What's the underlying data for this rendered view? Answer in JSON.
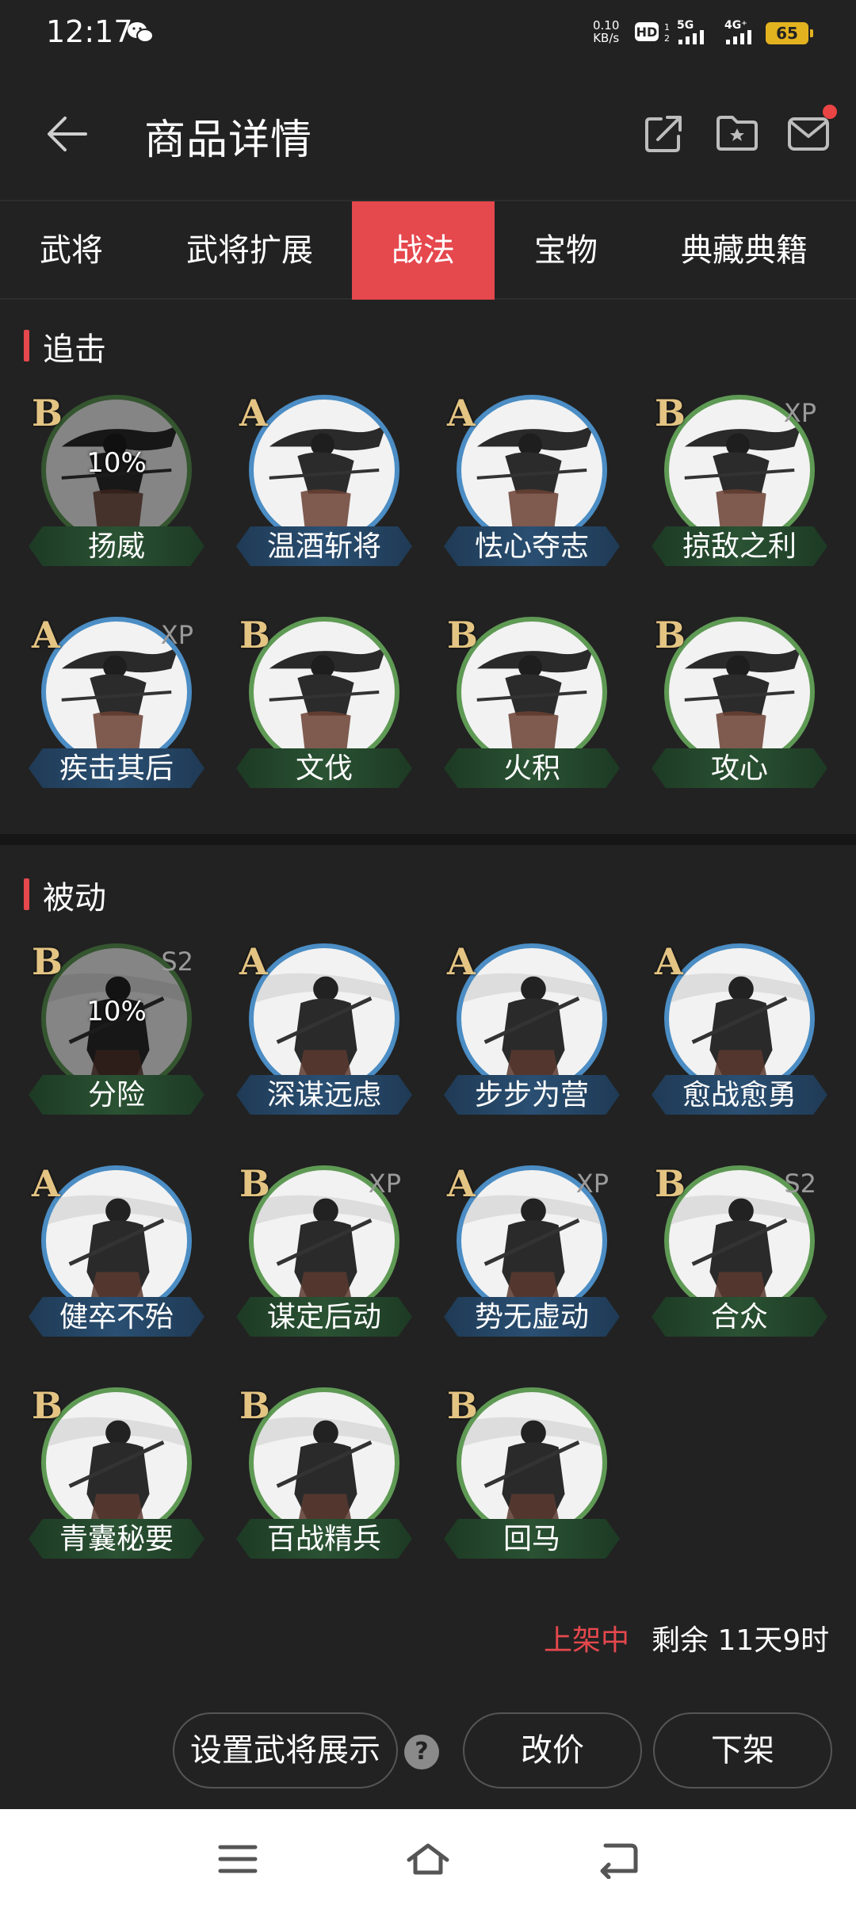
{
  "status_bar": {
    "time": "12:17",
    "net_speed_value": "0.10",
    "net_speed_unit": "KB/s",
    "hd_label": "HD",
    "network_5g": "5G",
    "network_4g": "4G⁺",
    "battery": "65"
  },
  "header": {
    "title": "商品详情"
  },
  "tabs": [
    {
      "label": "武将",
      "active": false
    },
    {
      "label": "武将扩展",
      "active": false
    },
    {
      "label": "战法",
      "active": true
    },
    {
      "label": "宝物",
      "active": false
    },
    {
      "label": "典藏典籍",
      "active": false
    }
  ],
  "sections": [
    {
      "title": "追击",
      "skills": [
        {
          "grade": "B",
          "name": "扬威",
          "ring": "green",
          "tag": "",
          "pct": "10%"
        },
        {
          "grade": "A",
          "name": "温酒斩将",
          "ring": "blue",
          "tag": "",
          "pct": ""
        },
        {
          "grade": "A",
          "name": "怯心夺志",
          "ring": "blue",
          "tag": "",
          "pct": ""
        },
        {
          "grade": "B",
          "name": "掠敌之利",
          "ring": "green",
          "tag": "XP",
          "pct": ""
        },
        {
          "grade": "A",
          "name": "疾击其后",
          "ring": "blue",
          "tag": "XP",
          "pct": ""
        },
        {
          "grade": "B",
          "name": "文伐",
          "ring": "green",
          "tag": "",
          "pct": ""
        },
        {
          "grade": "B",
          "name": "火积",
          "ring": "green",
          "tag": "",
          "pct": ""
        },
        {
          "grade": "B",
          "name": "攻心",
          "ring": "green",
          "tag": "",
          "pct": ""
        }
      ]
    },
    {
      "title": "被动",
      "skills": [
        {
          "grade": "B",
          "name": "分险",
          "ring": "green",
          "tag": "S2",
          "pct": "10%"
        },
        {
          "grade": "A",
          "name": "深谋远虑",
          "ring": "blue",
          "tag": "",
          "pct": ""
        },
        {
          "grade": "A",
          "name": "步步为营",
          "ring": "blue",
          "tag": "",
          "pct": ""
        },
        {
          "grade": "A",
          "name": "愈战愈勇",
          "ring": "blue",
          "tag": "",
          "pct": ""
        },
        {
          "grade": "A",
          "name": "健卒不殆",
          "ring": "blue",
          "tag": "",
          "pct": ""
        },
        {
          "grade": "B",
          "name": "谋定后动",
          "ring": "green",
          "tag": "XP",
          "pct": ""
        },
        {
          "grade": "A",
          "name": "势无虚动",
          "ring": "blue",
          "tag": "XP",
          "pct": ""
        },
        {
          "grade": "B",
          "name": "合众",
          "ring": "green",
          "tag": "S2",
          "pct": ""
        },
        {
          "grade": "B",
          "name": "青囊秘要",
          "ring": "green",
          "tag": "",
          "pct": ""
        },
        {
          "grade": "B",
          "name": "百战精兵",
          "ring": "green",
          "tag": "",
          "pct": ""
        },
        {
          "grade": "B",
          "name": "回马",
          "ring": "green",
          "tag": "",
          "pct": ""
        }
      ]
    }
  ],
  "listing": {
    "status": "上架中",
    "remaining": "剩余 11天9时"
  },
  "actions": {
    "set_display": "设置武将展示",
    "help": "?",
    "change_price": "改价",
    "delist": "下架"
  },
  "colors": {
    "accent": "#e5484d",
    "ring_blue": "#4b8dc4",
    "ring_green": "#5f9a55",
    "grade_gold": "#e4c483"
  },
  "icons": {
    "back": "arrow-left-icon",
    "share": "share-icon",
    "folder": "folder-star-icon",
    "mail": "mail-icon",
    "nav_menu": "menu-icon",
    "nav_home": "home-icon",
    "nav_back": "back-icon"
  }
}
